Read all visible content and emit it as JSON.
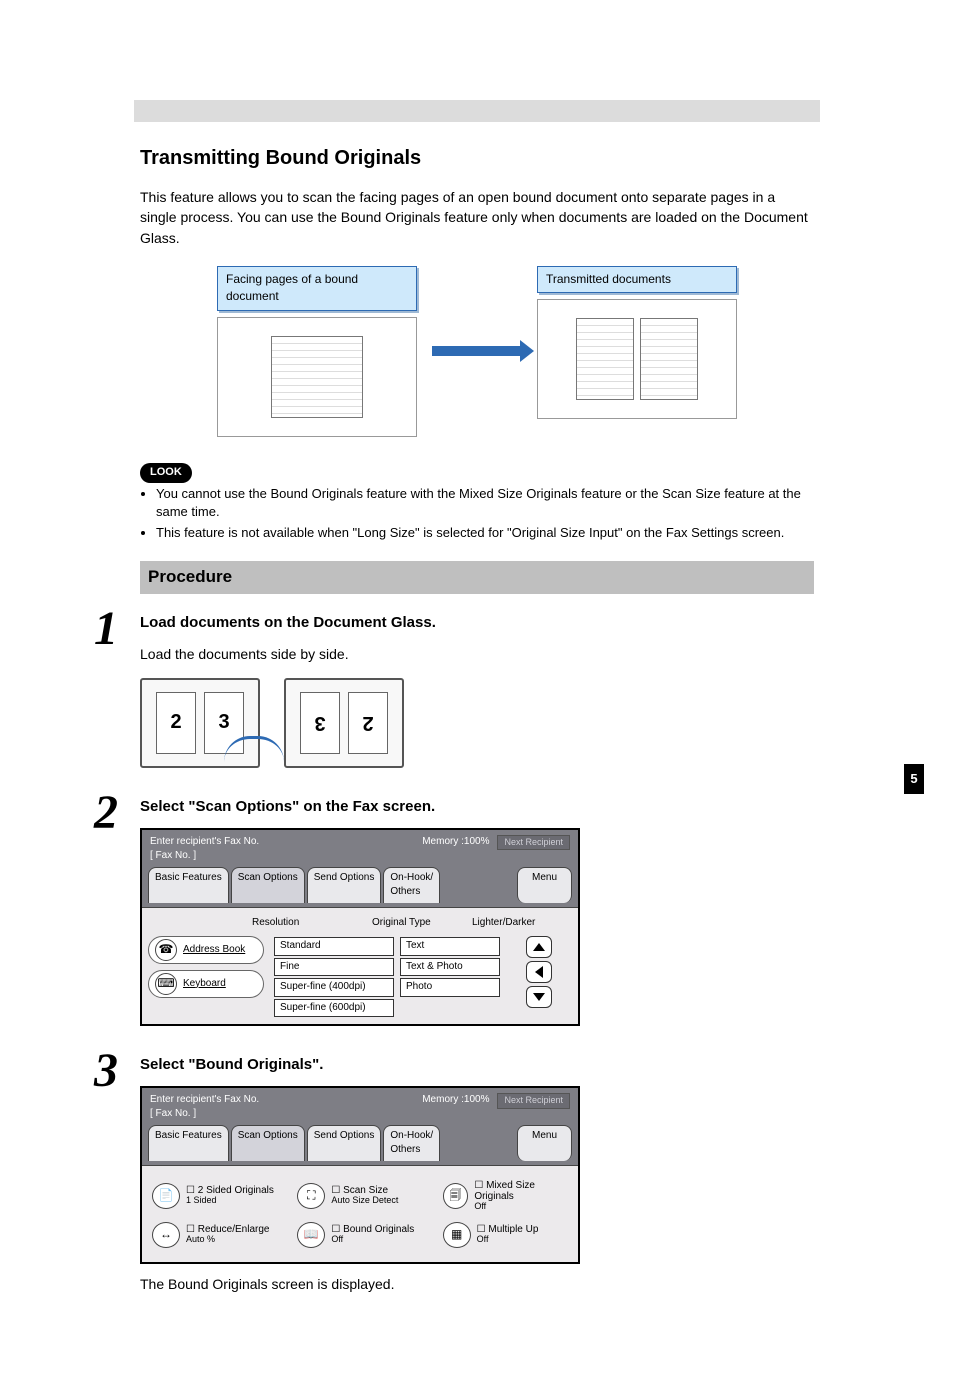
{
  "page": {
    "chapter_strip": "",
    "title": "Transmitting Bound Originals",
    "intro": "This feature allows you to scan the facing pages of an open bound document onto separate pages in a single process. You can use the Bound Originals feature only when documents are loaded on the Document Glass.",
    "figure": {
      "left_caption": "Facing pages of a bound document",
      "right_caption": "Transmitted documents"
    },
    "look_label": "LOOK",
    "notes": [
      "You cannot use the Bound Originals feature with the Mixed Size Originals feature or the Scan Size feature at the same time.",
      "This feature is not available when \"Long Size\" is selected for \"Original Size Input\" on the Fax Settings screen."
    ],
    "procedure_heading": "Procedure"
  },
  "steps": {
    "s1": {
      "num": "1",
      "instr": "Load documents on the Document Glass.",
      "body": "Load the documents side by side.",
      "left_sheets": [
        "2",
        "3"
      ],
      "right_sheets": [
        "3",
        "2"
      ]
    },
    "s2": {
      "num": "2",
      "instr": "Select \"Scan Options\" on the Fax screen."
    },
    "s3": {
      "num": "3",
      "instr": "Select \"Bound Originals\".",
      "body": "The Bound Originals screen is displayed."
    }
  },
  "lcd1": {
    "header_left1": "Enter recipient's Fax No.",
    "header_left2": "[  Fax No.  ]",
    "memory": "Memory :100%",
    "next": "Next Recipient",
    "tabs": {
      "basic": "Basic Features",
      "scan": "Scan Options",
      "send": "Send Options",
      "onhook": "On-Hook/",
      "others": "Others",
      "menu": "Menu"
    },
    "headings": {
      "res": "Resolution",
      "otype": "Original Type",
      "ld": "Lighter/Darker"
    },
    "addr_book": "Address Book",
    "keyboard": "Keyboard",
    "res_opts": [
      "Standard",
      "Fine",
      "Super-fine (400dpi)",
      "Super-fine (600dpi)"
    ],
    "type_opts": [
      "Text",
      "Text & Photo",
      "Photo"
    ]
  },
  "lcd2": {
    "header_left1": "Enter recipient's Fax No.",
    "header_left2": "[  Fax No.  ]",
    "memory": "Memory :100%",
    "next": "Next Recipient",
    "tabs": {
      "basic": "Basic Features",
      "scan": "Scan Options",
      "send": "Send Options",
      "onhook": "On-Hook/",
      "others": "Others",
      "menu": "Menu"
    },
    "opts": {
      "twosided_t": "2 Sided Originals",
      "twosided_s": "1 Sided",
      "scansize_t": "Scan Size",
      "scansize_s": "Auto Size Detect",
      "mixed_t": "Mixed Size Originals",
      "mixed_s": "Off",
      "reduce_t": "Reduce/Enlarge",
      "reduce_s": "Auto %",
      "bound_t": "Bound Originals",
      "bound_s": "Off",
      "multi_t": "Multiple Up",
      "multi_s": "Off"
    }
  },
  "footer": {
    "pagenum": "5"
  }
}
